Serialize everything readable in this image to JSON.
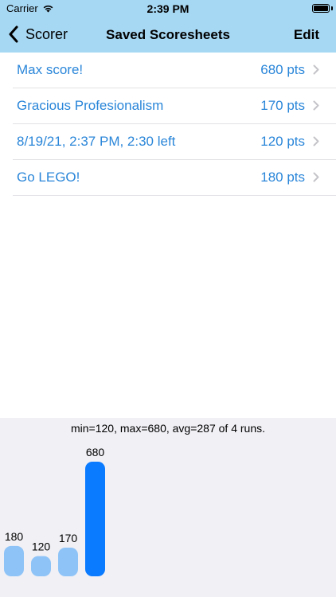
{
  "status_bar": {
    "carrier": "Carrier",
    "time": "2:39 PM",
    "icons": [
      "wifi-icon",
      "battery-icon"
    ]
  },
  "nav": {
    "back_label": "Scorer",
    "title": "Saved Scoresheets",
    "edit_label": "Edit",
    "tint": "#000000",
    "background": "#a7d8f3"
  },
  "rows": [
    {
      "title": "Max score!",
      "score": "680 pts"
    },
    {
      "title": "Gracious Profesionalism",
      "score": "170 pts"
    },
    {
      "title": "8/19/21, 2:37 PM, 2:30 left",
      "score": "120 pts"
    },
    {
      "title": "Go LEGO!",
      "score": "180 pts"
    }
  ],
  "row_text_color": "#2a86d9",
  "stats": {
    "summary": "min=120, max=680, avg=287 of 4 runs."
  },
  "chart_data": {
    "type": "bar",
    "title": "",
    "xlabel": "",
    "ylabel": "",
    "categories": [
      "Go LEGO!",
      "8/19/21, 2:37 PM, 2:30 left",
      "Gracious Profesionalism",
      "Max score!"
    ],
    "values": [
      180,
      120,
      170,
      680
    ],
    "labels": [
      "180",
      "120",
      "170",
      "680"
    ],
    "highlight_index": 3,
    "colors": {
      "bar": "#8ec3f7",
      "highlight": "#0a7aff"
    },
    "ylim": [
      0,
      680
    ],
    "grid": false,
    "legend": "none"
  }
}
